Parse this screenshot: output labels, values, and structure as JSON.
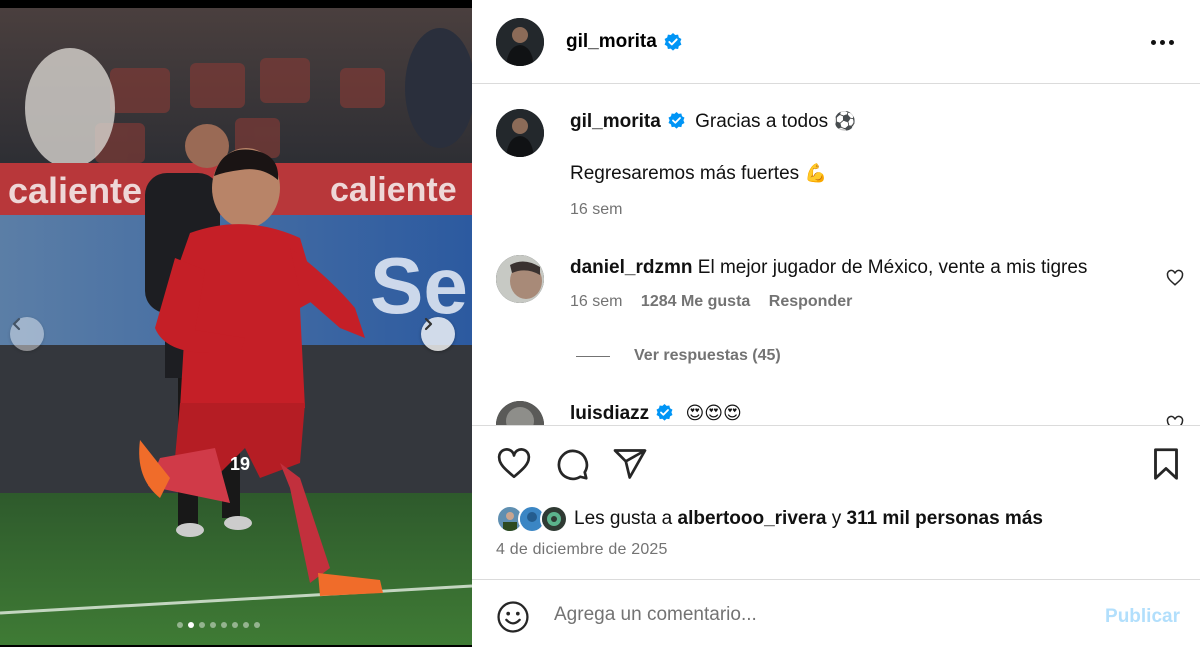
{
  "post": {
    "username": "gil_morita",
    "caption_line1": "Gracias a todos",
    "caption_line2": "Regresaremos más fuertes",
    "caption_emoji1": "⚽",
    "caption_emoji2": "💪",
    "caption_time": "16 sem",
    "date": "4 de diciembre de 2025"
  },
  "photo": {
    "current_slide": 2,
    "total_slides": 8
  },
  "comments": [
    {
      "username": "daniel_rdzmn",
      "text": "El mejor jugador de México, vente a mis tigres",
      "time": "16 sem",
      "likes": "1284 Me gusta",
      "reply_label": "Responder",
      "view_replies": "Ver respuestas (45)"
    },
    {
      "username": "luisdiazz",
      "text": "😍😍😍"
    }
  ],
  "likes": {
    "prefix": "Les gusta a",
    "user": "albertooo_rivera",
    "connector": "y",
    "others": "311 mil personas más"
  },
  "composer": {
    "placeholder": "Agrega un comentario...",
    "publish_label": "Publicar"
  },
  "colors": {
    "verified": "#0095f6",
    "publish_disabled": "#b2dffc",
    "secondary_text": "#737373",
    "divider": "#dbdbdb"
  }
}
